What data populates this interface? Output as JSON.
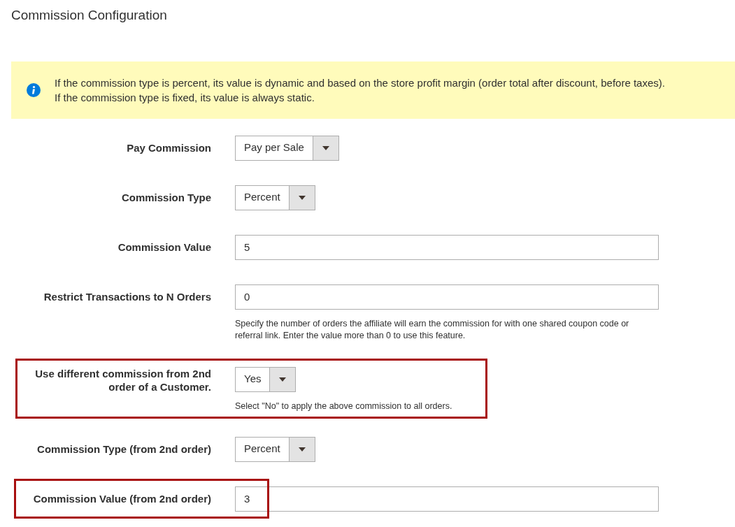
{
  "title": "Commission Configuration",
  "notice": {
    "lines": [
      "If the commission type is percent, its value is dynamic and based on the store profit margin (order total after discount, before taxes).",
      "If the commission type is fixed, its value is always static."
    ]
  },
  "fields": [
    {
      "label": "Pay Commission",
      "kind": "select",
      "value": "Pay per Sale",
      "highlighted": false
    },
    {
      "label": "Commission Type",
      "kind": "select",
      "value": "Percent",
      "highlighted": false
    },
    {
      "label": "Commission Value",
      "kind": "input",
      "value": "5",
      "highlighted": false
    },
    {
      "label": "Restrict Transactions to N Orders",
      "kind": "input",
      "value": "0",
      "note": "Specify the number of orders the affiliate will earn the commission for with one shared coupon code or referral link. Enter the value more than 0 to use this feature.",
      "highlighted": false
    },
    {
      "label": "Use different commission from 2nd order of a Customer.",
      "kind": "select",
      "value": "Yes",
      "note": "Select \"No\" to apply the above commission to all orders.",
      "highlighted": true
    },
    {
      "label": "Commission Type (from 2nd order)",
      "kind": "select",
      "value": "Percent",
      "highlighted": false
    },
    {
      "label": "Commission Value (from 2nd order)",
      "kind": "input",
      "value": "3",
      "highlighted": true
    }
  ]
}
